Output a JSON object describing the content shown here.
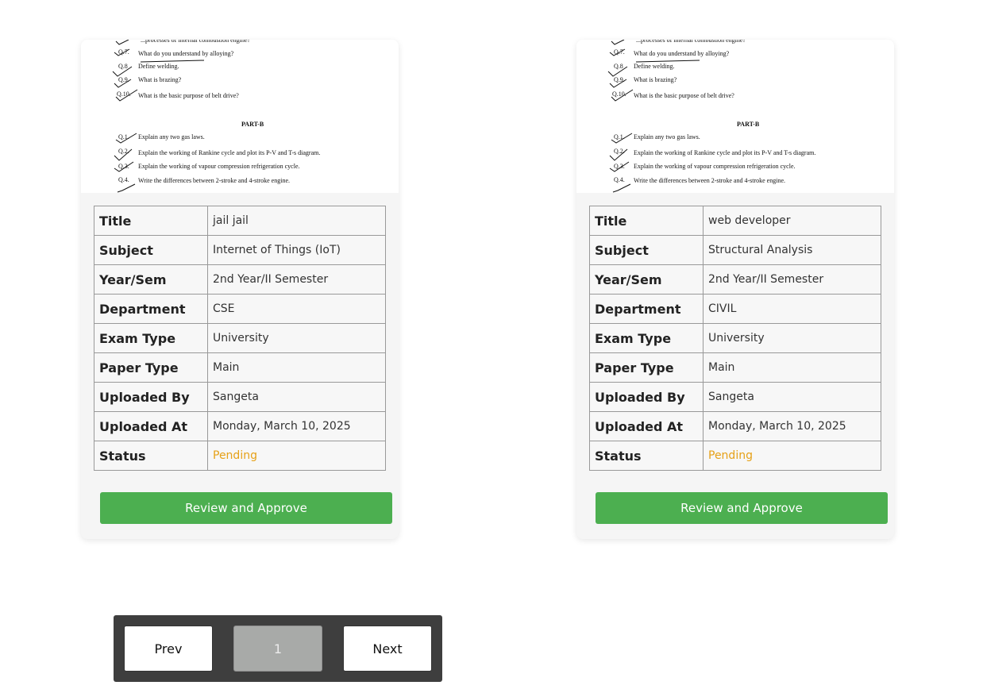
{
  "cards": [
    {
      "preview": {
        "lines": [
          "What do you understand by alloying?",
          "Define welding.",
          "What is brazing?",
          "What is the basic purpose of belt drive?",
          "PART-B",
          "Explain any two gas laws.",
          "Explain the working of Rankine cycle and plot its P-V and T-s diagram.",
          "Explain the working of vapour compression refrigeration cycle.",
          "Write the differences between 2-stroke and 4-stroke engine."
        ],
        "qnos": [
          "Q.7.",
          "Q.8",
          "Q.9.",
          "Q.10.",
          "Q.1.",
          "Q.2.",
          "Q.3.",
          "Q.4."
        ]
      },
      "labels": {
        "title": "Title",
        "subject": "Subject",
        "year_sem": "Year/Sem",
        "department": "Department",
        "exam_type": "Exam Type",
        "paper_type": "Paper Type",
        "uploaded_by": "Uploaded By",
        "uploaded_at": "Uploaded At",
        "status": "Status"
      },
      "values": {
        "title": "jail jail",
        "subject": "Internet of Things (IoT)",
        "year_sem": "2nd Year/II Semester",
        "department": "CSE",
        "exam_type": "University",
        "paper_type": "Main",
        "uploaded_by": "Sangeta",
        "uploaded_at": "Monday, March 10, 2025",
        "status": "Pending"
      },
      "button": "Review and Approve"
    },
    {
      "preview": {
        "lines": [
          "What do you understand by alloying?",
          "Define welding.",
          "What is brazing?",
          "What is the basic purpose of belt drive?",
          "PART-B",
          "Explain any two gas laws.",
          "Explain the working of Rankine cycle and plot its P-V and T-s diagram.",
          "Explain the working of vapour compression refrigeration cycle.",
          "Write the differences between 2-stroke and 4-stroke engine."
        ],
        "qnos": [
          "Q.7.",
          "Q.8",
          "Q.9.",
          "Q.10.",
          "Q.1.",
          "Q.2.",
          "Q.3.",
          "Q.4."
        ]
      },
      "labels": {
        "title": "Title",
        "subject": "Subject",
        "year_sem": "Year/Sem",
        "department": "Department",
        "exam_type": "Exam Type",
        "paper_type": "Paper Type",
        "uploaded_by": "Uploaded By",
        "uploaded_at": "Uploaded At",
        "status": "Status"
      },
      "values": {
        "title": "web developer",
        "subject": "Structural Analysis",
        "year_sem": "2nd Year/II Semester",
        "department": "CIVIL",
        "exam_type": "University",
        "paper_type": "Main",
        "uploaded_by": "Sangeta",
        "uploaded_at": "Monday, March 10, 2025",
        "status": "Pending"
      },
      "button": "Review and Approve"
    }
  ],
  "pagination": {
    "prev_label": "Prev",
    "current_page": "1",
    "next_label": "Next"
  },
  "colors": {
    "approve_button": "#4caf50",
    "pending_status": "#e6a118",
    "pager_background": "#3e3e3e",
    "current_page_background": "#a8aaa8"
  }
}
